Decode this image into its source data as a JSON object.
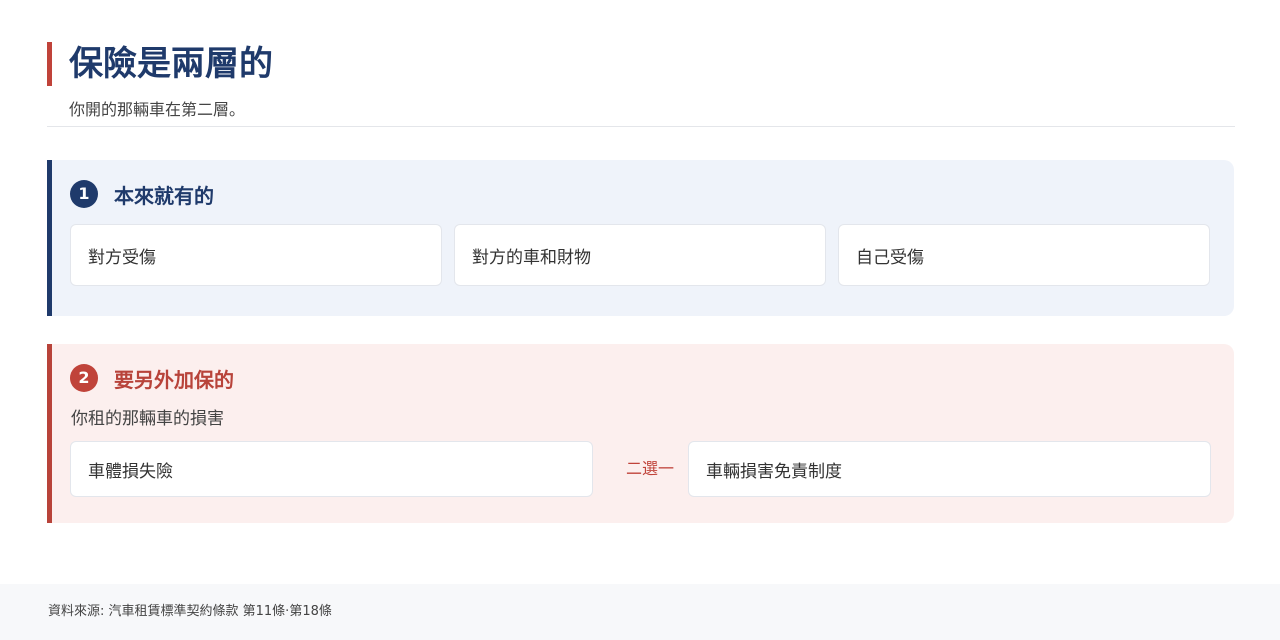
{
  "header": {
    "title": "保險是兩層的",
    "subtitle": "你開的那輛車在第二層。"
  },
  "layers": [
    {
      "number": "1",
      "title": "本來就有的",
      "items": [
        "對方受傷",
        "對方的車和財物",
        "自己受傷"
      ]
    },
    {
      "number": "2",
      "title": "要另外加保的",
      "description": "你租的那輛車的損害",
      "items": [
        "車體損失險",
        "車輛損害免責制度"
      ],
      "connector": "二選一"
    }
  ],
  "footer": {
    "source": "資料來源: 汽車租賃標準契約條款 第11條·第18條"
  },
  "colors": {
    "navy": "#1f3a6b",
    "red": "#c0433a",
    "layer1_bg": "#eff3fa",
    "layer2_bg": "#fcefee"
  }
}
